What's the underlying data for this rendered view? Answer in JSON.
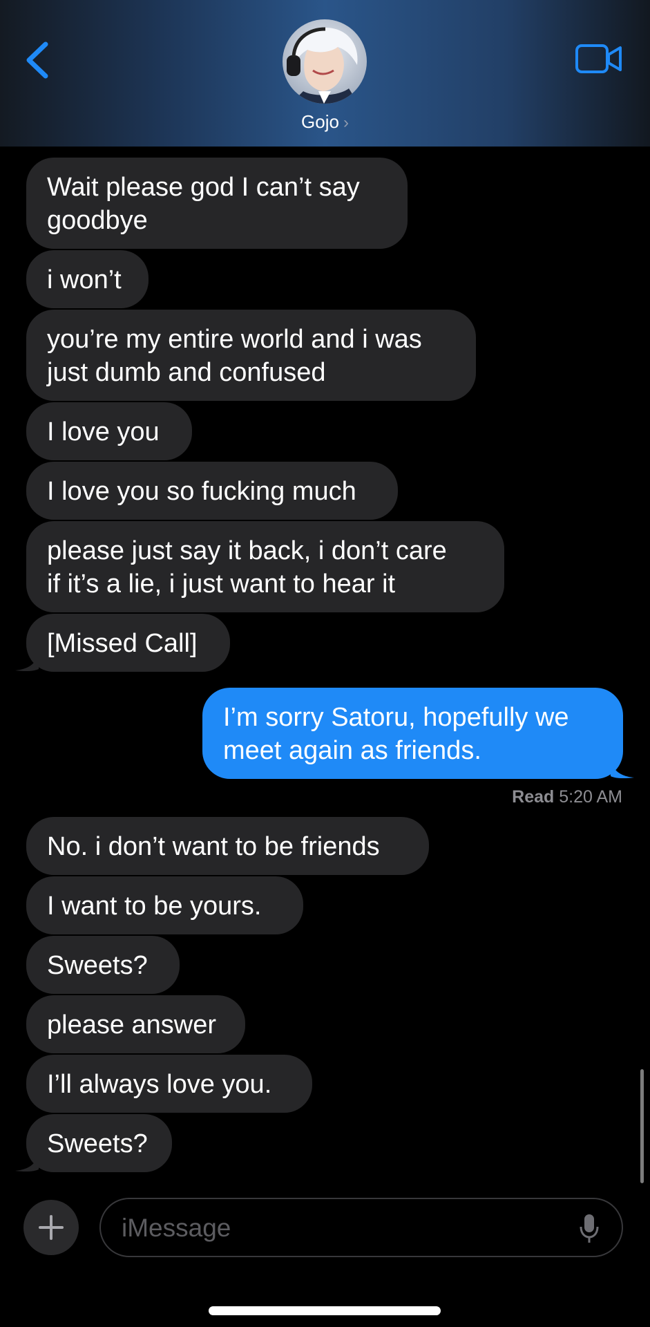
{
  "header": {
    "contact_name": "Gojo",
    "name_chevron": "›",
    "back_icon": "chevron-left-icon",
    "video_icon": "video-camera-icon",
    "accent_color": "#1f8af7"
  },
  "messages": [
    {
      "direction": "in",
      "text_lines": [
        "Wait please god I can’t say",
        "goodbye"
      ]
    },
    {
      "direction": "in",
      "text_lines": [
        "i won’t"
      ]
    },
    {
      "direction": "in",
      "text_lines": [
        "you’re my entire world and i was",
        "just dumb and confused"
      ]
    },
    {
      "direction": "in",
      "text_lines": [
        "I love you"
      ]
    },
    {
      "direction": "in",
      "text_lines": [
        "I love you so fucking much"
      ]
    },
    {
      "direction": "in",
      "text_lines": [
        "please just say it back, i don’t care",
        "if it’s a lie, i just want to hear it"
      ]
    },
    {
      "direction": "in",
      "text_lines": [
        "[Missed Call]"
      ]
    },
    {
      "direction": "out",
      "text_lines": [
        "I’m sorry Satoru, hopefully we",
        "meet again as friends."
      ]
    },
    {
      "direction": "in",
      "text_lines": [
        "No. i don’t want to be friends"
      ]
    },
    {
      "direction": "in",
      "text_lines": [
        "I want to be yours."
      ]
    },
    {
      "direction": "in",
      "text_lines": [
        "Sweets?"
      ]
    },
    {
      "direction": "in",
      "text_lines": [
        "please answer"
      ]
    },
    {
      "direction": "in",
      "text_lines": [
        "I’ll always love you."
      ]
    },
    {
      "direction": "in",
      "text_lines": [
        "Sweets?"
      ]
    }
  ],
  "read_receipt": {
    "label": "Read",
    "time": "5:20 AM"
  },
  "compose": {
    "placeholder": "iMessage",
    "plus_icon": "plus-icon",
    "mic_icon": "microphone-icon"
  },
  "colors": {
    "incoming_bubble": "#262628",
    "outgoing_bubble": "#1f8af7",
    "background": "#000000"
  }
}
